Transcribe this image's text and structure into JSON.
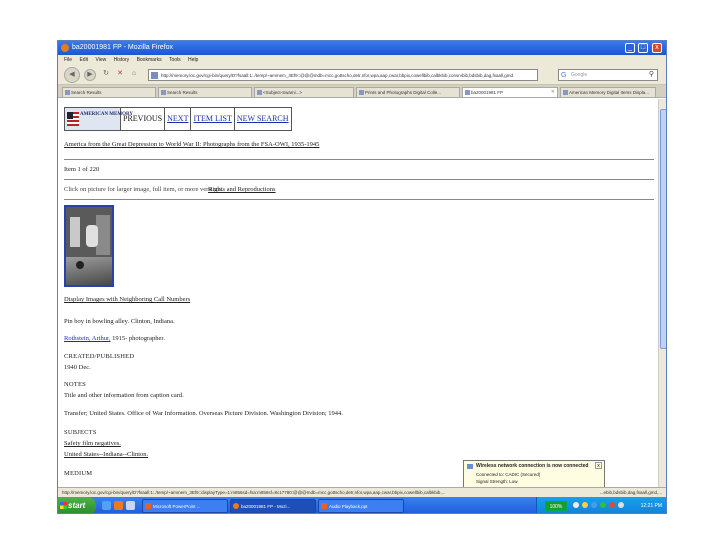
{
  "window": {
    "title": "ba20001981 FP - Mozilla Firefox",
    "controls": {
      "minimize": "_",
      "maximize": "□",
      "close": "x"
    }
  },
  "menu": [
    "File",
    "Edit",
    "View",
    "History",
    "Bookmarks",
    "Tools",
    "Help"
  ],
  "nav": {
    "back": "◀",
    "forward": "▶",
    "reload": "↻",
    "stop": "✕",
    "home": "⌂",
    "url": "http://memory.loc.gov/cgi-bin/query/D?fsaall:1:./temp/~ammem_3Ef9::@@@mdb=mcc,gottscho,detr,nfor,wpa,aap,cwar,bbpix,cowellbib,calbkbib,consrvbib,bdsbib,dag,fsaall,gmd",
    "search_placeholder": "Google",
    "search_engine_icon": "G"
  },
  "tabs": [
    {
      "label": "Search Results",
      "active": false
    },
    {
      "label": "Search Results",
      "active": false
    },
    {
      "label": "<Subject-Swami...>",
      "active": false
    },
    {
      "label": "Prints and Photographs Digital Colle...",
      "active": false
    },
    {
      "label": "ba20001981 FP",
      "active": true
    },
    {
      "label": "American Memory Digital Items Displa...",
      "active": false
    }
  ],
  "page": {
    "logo_text": "AMERICAN MEMORY",
    "nav_links": [
      "PREVIOUS",
      "NEXT",
      "ITEM LIST",
      "NEW SEARCH"
    ],
    "collection_link": "America from the Great Depression to World War II: Photographs from the FSA-OWI, 1935-1945",
    "item_count": "Item 1 of 220",
    "enlarge_text": "Click on picture for larger image, full item, or more versions.",
    "rights_link": "Rights and Reproductions",
    "neighbor_link": "Display Images with Neighboring Call Numbers",
    "item_title": "Pin boy in bowling alley. Clinton, Indiana.",
    "creator_link": "Rothstein, Arthur,",
    "creator_suffix": "1915-  photographer.",
    "created_label": "CREATED/PUBLISHED",
    "created_value": "1940 Dec.",
    "notes_label": "NOTES",
    "notes_1": "Title and other information from caption card.",
    "notes_2": "Transfer; United States. Office of War Information. Overseas Picture Division. Washington Division; 1944.",
    "subjects_label": "SUBJECTS",
    "subject_1": "Safety film negatives.",
    "subject_2": "United States--Indiana--Clinton.",
    "medium_label": "MEDIUM"
  },
  "popup": {
    "title": "Wireless network connection is now connected",
    "line1": "Connected to: CADIC (Secured)",
    "line2": "Signal Strength: Low",
    "close": "x"
  },
  "status": {
    "url": "http://memory.loc.gov/cgi-bin/query/D?fsaall:1:./temp/~ammem_3Ef9::displayType=1:m856sd=fsa:m856sf=8c17780:@@@mdb=mcc,gottscho,detr,nfor,wpa,aap,cwar,bbpix,cowellbib,calbkbib,...",
    "right": "...ebib,bdsbib,dag,fsaall,gmd,..."
  },
  "taskbar": {
    "start": "start",
    "tasks": [
      {
        "label": "Microsoft PowerPoint ...",
        "active": false
      },
      {
        "label": "ba20001981 FP - Mozi...",
        "active": true
      },
      {
        "label": "Audio Playback.ppt",
        "active": false
      }
    ],
    "battery": "100%",
    "clock": "12:21 PM"
  }
}
